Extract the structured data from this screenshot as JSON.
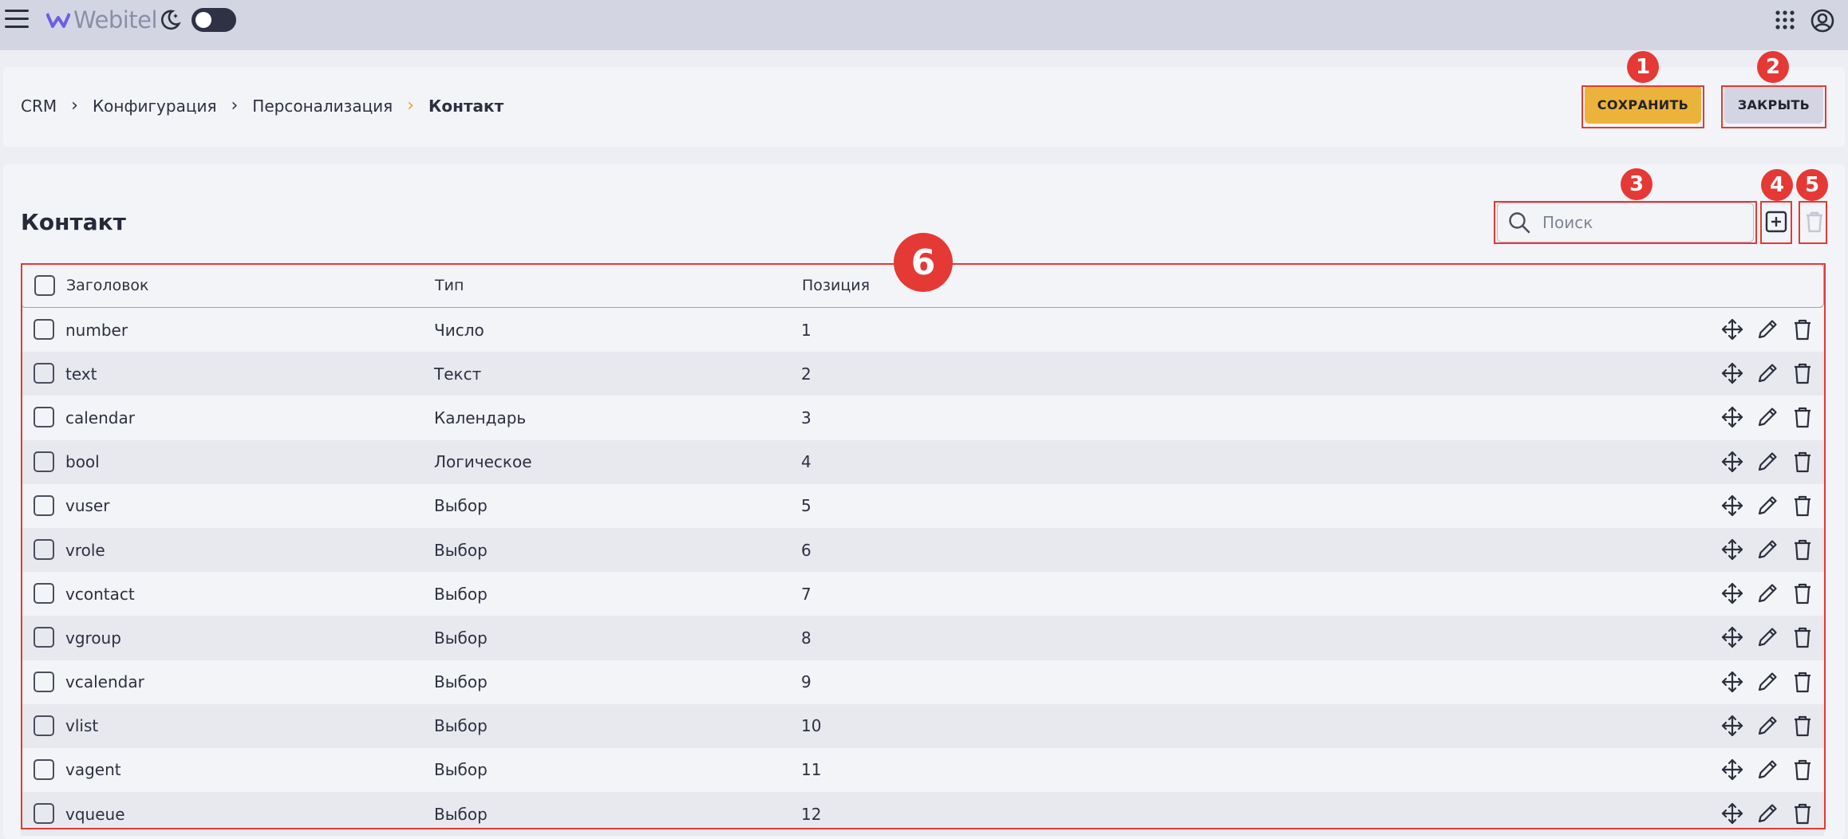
{
  "topbar": {
    "brand": "Webitel",
    "icons": [
      "menu-icon",
      "moon-icon",
      "theme-toggle",
      "apps-grid-icon",
      "account-icon"
    ]
  },
  "breadcrumb": [
    "CRM",
    "Конфигурация",
    "Персонализация",
    "Контакт"
  ],
  "buttons": {
    "save": "СОХРАНИТЬ",
    "close": "ЗАКРЫТЬ"
  },
  "section": {
    "title": "Контакт"
  },
  "search": {
    "placeholder": "Поиск",
    "value": ""
  },
  "table": {
    "headers": [
      "Заголовок",
      "Тип",
      "Позиция"
    ],
    "rows": [
      {
        "title": "number",
        "type": "Число",
        "position": "1"
      },
      {
        "title": "text",
        "type": "Текст",
        "position": "2"
      },
      {
        "title": "calendar",
        "type": "Календарь",
        "position": "3"
      },
      {
        "title": "bool",
        "type": "Логическое",
        "position": "4"
      },
      {
        "title": "vuser",
        "type": "Выбор",
        "position": "5"
      },
      {
        "title": "vrole",
        "type": "Выбор",
        "position": "6"
      },
      {
        "title": "vcontact",
        "type": "Выбор",
        "position": "7"
      },
      {
        "title": "vgroup",
        "type": "Выбор",
        "position": "8"
      },
      {
        "title": "vcalendar",
        "type": "Выбор",
        "position": "9"
      },
      {
        "title": "vlist",
        "type": "Выбор",
        "position": "10"
      },
      {
        "title": "vagent",
        "type": "Выбор",
        "position": "11"
      },
      {
        "title": "vqueue",
        "type": "Выбор",
        "position": "12"
      }
    ],
    "row_actions": [
      "move-icon",
      "edit-icon",
      "delete-icon"
    ]
  },
  "annotations": [
    "1",
    "2",
    "3",
    "4",
    "5",
    "6"
  ],
  "colors": {
    "accent": "#ecb33c",
    "annotation": "#e53935",
    "topbar": "#d3d6e2"
  }
}
